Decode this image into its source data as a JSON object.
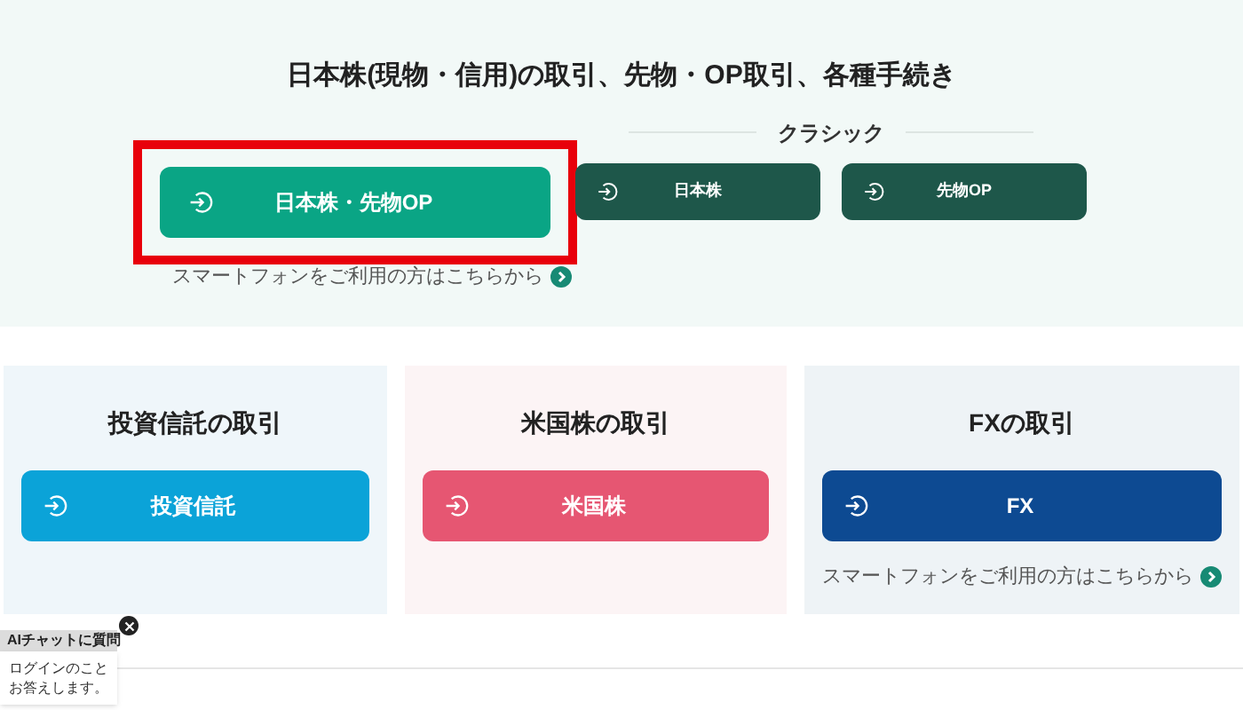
{
  "top_section": {
    "title": "日本株(現物・信用)の取引、先物・OP取引、各種手続き",
    "main_button": {
      "label": "日本株・先物OP",
      "highlighted": true
    },
    "classic": {
      "label": "クラシック",
      "buttons": [
        {
          "label": "日本株"
        },
        {
          "label": "先物OP"
        }
      ]
    },
    "smartphone_link": "スマートフォンをご利用の方はこちらから"
  },
  "cards": [
    {
      "title": "投資信託の取引",
      "button": "投資信託",
      "color": "#0ba3d8"
    },
    {
      "title": "米国株の取引",
      "button": "米国株",
      "color": "#e65672"
    },
    {
      "title": "FXの取引",
      "button": "FX",
      "color": "#0d4a92",
      "smartphone_link": "スマートフォンをご利用の方はこちらから"
    }
  ],
  "chat_widget": {
    "title": "AIチャットに質問",
    "message_lines": [
      "ログインのこと",
      "お答えします。"
    ]
  }
}
